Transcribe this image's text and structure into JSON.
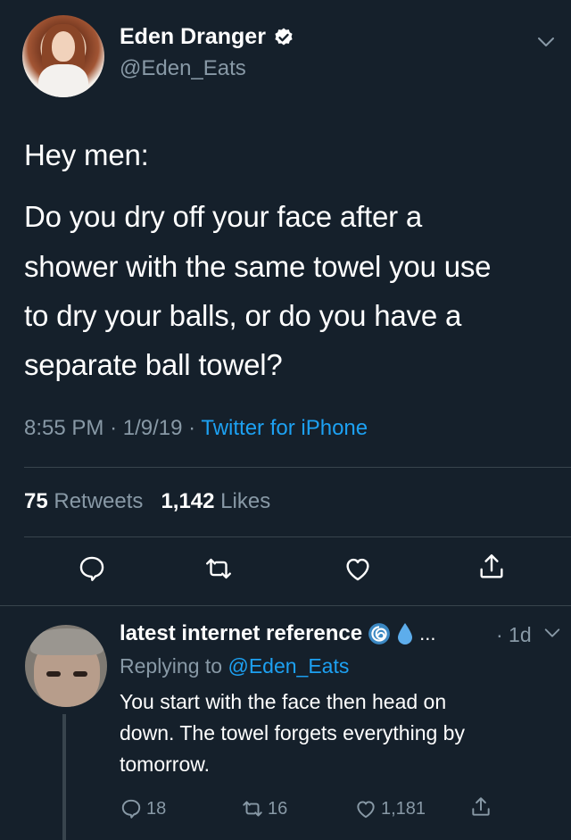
{
  "tweet": {
    "author_name": "Eden Dranger",
    "author_handle": "@Eden_Eats",
    "text_lines": [
      "Hey men:",
      "Do you dry off your face after a",
      "shower with the same towel you use",
      "to dry your balls, or do you have a",
      "separate ball towel?"
    ],
    "time": "8:55 PM",
    "date": "1/9/19",
    "source": "Twitter for iPhone",
    "retweets_count": "75",
    "retweets_label": "Retweets",
    "likes_count": "1,142",
    "likes_label": "Likes"
  },
  "reply": {
    "author_name": "latest internet reference",
    "name_ellipsis": "...",
    "time": "· 1d",
    "replying_label": "Replying to",
    "replying_handle": "@Eden_Eats",
    "text_lines": [
      "You start with the face then head on",
      "down. The towel forgets everything by",
      "tomorrow."
    ],
    "reply_count": "18",
    "retweet_count": "16",
    "like_count": "1,181"
  },
  "colors": {
    "background": "#15202b",
    "secondary_text": "#8899a6",
    "link": "#1da1f2",
    "divider": "#38444d"
  },
  "icons": [
    "verified-badge-icon",
    "chevron-down-icon",
    "reply-icon",
    "retweet-icon",
    "like-icon",
    "share-icon",
    "cyclone-emoji-icon",
    "droplet-emoji-icon"
  ]
}
